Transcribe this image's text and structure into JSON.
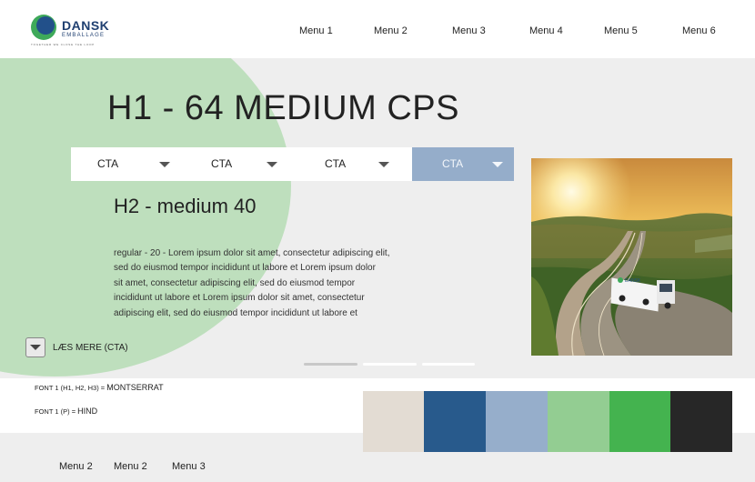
{
  "header": {
    "logo": {
      "word1": "DANSK",
      "word2": "EMBALLAGE",
      "tagline": "TOGETHER WE CLOSE THE LOOP",
      "colors": {
        "circle_front": "#22508a",
        "circle_back": "#3ea95a"
      }
    },
    "nav": [
      "Menu 1",
      "Menu 2",
      "Menu 3",
      "Menu 4",
      "Menu 5",
      "Menu 6"
    ]
  },
  "hero": {
    "title": "H1 - 64 MEDIUM CPS",
    "ctas": [
      {
        "label": "CTA",
        "active": false
      },
      {
        "label": "CTA",
        "active": false
      },
      {
        "label": "CTA",
        "active": false
      },
      {
        "label": "CTA",
        "active": true
      }
    ],
    "subtitle": "H2 - medium 40",
    "body_lines": [
      "regular - 20 - Lorem ipsum dolor sit amet, consectetur adipiscing elit,",
      "sed do eiusmod tempor incididunt ut labore et  Lorem ipsum dolor",
      "sit amet, consectetur adipiscing elit, sed do eiusmod tempor",
      "incididunt ut labore et  Lorem ipsum dolor sit amet, consectetur",
      "adipiscing elit, sed do eiusmod tempor incididunt ut labore et"
    ],
    "image": {
      "subject": "truck-on-highway-sunset",
      "truck_text": "DANSK"
    },
    "read_more": "LÆS MERE (CTA)",
    "carousel": {
      "slides": 3,
      "active_index": 0
    }
  },
  "fonts": {
    "font1": {
      "label": "FONT 1 (H1, H2, H3) = ",
      "value": "MONTSERRAT"
    },
    "font2": {
      "label": "FONT 1 (P) = ",
      "value": "HIND"
    }
  },
  "palette": [
    "#e3dcd3",
    "#285a8c",
    "#96aecb",
    "#93cd92",
    "#44b34f",
    "#272727"
  ],
  "footer": {
    "nav": [
      "Menu 2",
      "Menu 2",
      "Menu 3"
    ]
  }
}
